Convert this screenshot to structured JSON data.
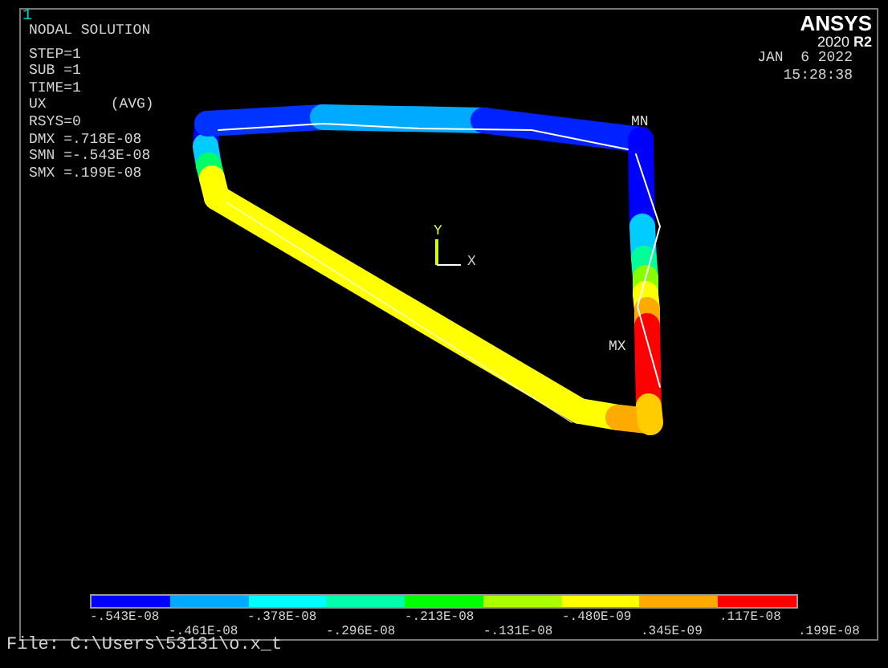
{
  "window_number": "1",
  "title": "NODAL SOLUTION",
  "info": [
    {
      "text": "STEP=1"
    },
    {
      "text": "SUB =1"
    },
    {
      "text": "TIME=1"
    },
    {
      "text": "UX",
      "suffix": "(AVG)"
    },
    {
      "text": "RSYS=0"
    },
    {
      "text": "DMX =.718E-08"
    },
    {
      "text": "SMN =-.543E-08"
    },
    {
      "text": "SMX =.199E-08"
    }
  ],
  "logo": {
    "name": "ANSYS",
    "version": "2020",
    "release": "R2"
  },
  "date": "JAN  6 2022",
  "time": "15:28:38",
  "node_labels": {
    "min": "MN",
    "max": "MX"
  },
  "triad": {
    "y": "Y",
    "x": "X"
  },
  "legend": {
    "bands": [
      {
        "color": "#0000ff"
      },
      {
        "color": "#00aaff"
      },
      {
        "color": "#00ffff"
      },
      {
        "color": "#00ffaa"
      },
      {
        "color": "#00ff00"
      },
      {
        "color": "#aaff00"
      },
      {
        "color": "#ffff00"
      },
      {
        "color": "#ffaa00"
      },
      {
        "color": "#ff0000"
      }
    ],
    "labels": [
      "-.543E-08",
      "-.461E-08",
      "-.378E-08",
      "-.296E-08",
      "-.213E-08",
      "-.131E-08",
      "-.480E-09",
      ".345E-09",
      ".117E-08",
      ".199E-08"
    ]
  },
  "file": "File: C:\\Users\\53131\\o.x_t"
}
